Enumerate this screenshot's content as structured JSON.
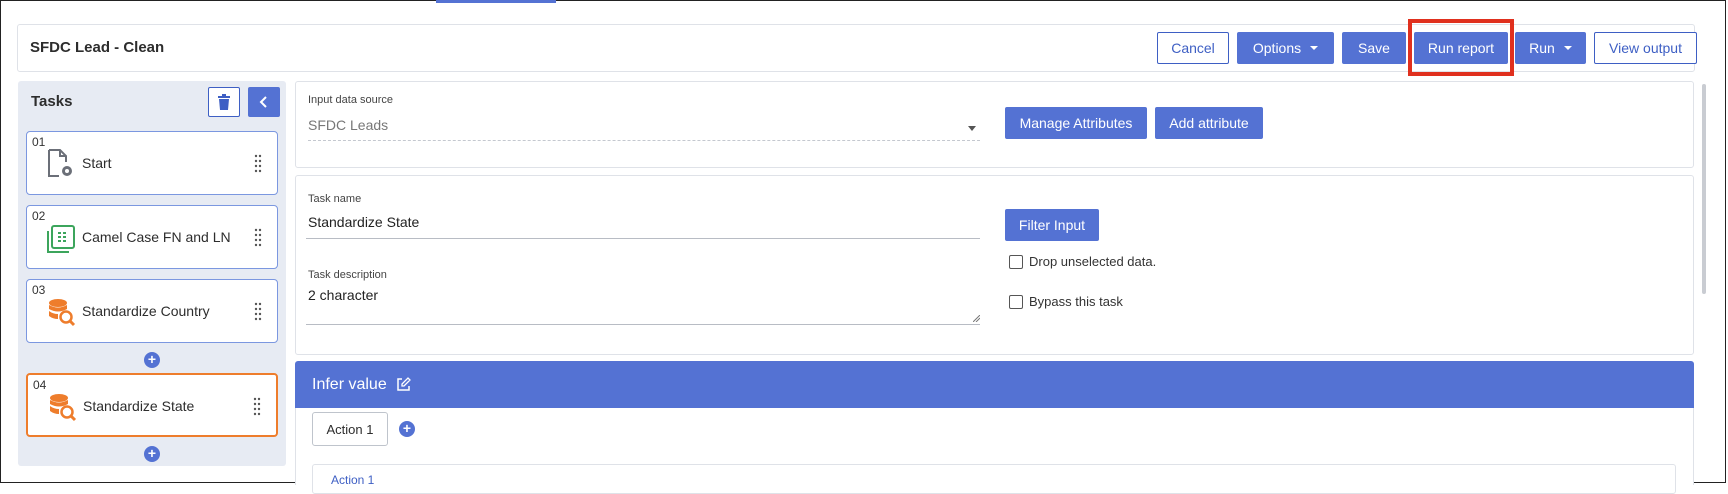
{
  "header": {
    "title": "SFDC Lead - Clean",
    "buttons": {
      "cancel": "Cancel",
      "options": "Options",
      "save": "Save",
      "run_report": "Run report",
      "run": "Run",
      "view_output": "View output"
    }
  },
  "tasks": {
    "title": "Tasks",
    "items": [
      {
        "num": "01",
        "label": "Start",
        "icon": "file-gear-icon"
      },
      {
        "num": "02",
        "label": "Camel Case FN and LN",
        "icon": "sheet-icon"
      },
      {
        "num": "03",
        "label": "Standardize Country",
        "icon": "database-search-icon"
      },
      {
        "num": "04",
        "label": "Standardize State",
        "icon": "database-search-icon",
        "active": true
      }
    ]
  },
  "source": {
    "label": "Input data source",
    "value": "SFDC Leads",
    "manage_attributes": "Manage Attributes",
    "add_attribute": "Add attribute"
  },
  "task_form": {
    "name_label": "Task name",
    "name_value": "Standardize State",
    "description_label": "Task description",
    "description_value": "2 character",
    "filter_input": "Filter Input",
    "drop_unselected": "Drop unselected data.",
    "bypass": "Bypass this task"
  },
  "infer": {
    "title": "Infer value",
    "action_tab": "Action 1",
    "action_title": "Action 1"
  },
  "colors": {
    "accent": "#5472d3",
    "active_task_border": "#ee7d2c",
    "highlight": "#e0301e"
  }
}
